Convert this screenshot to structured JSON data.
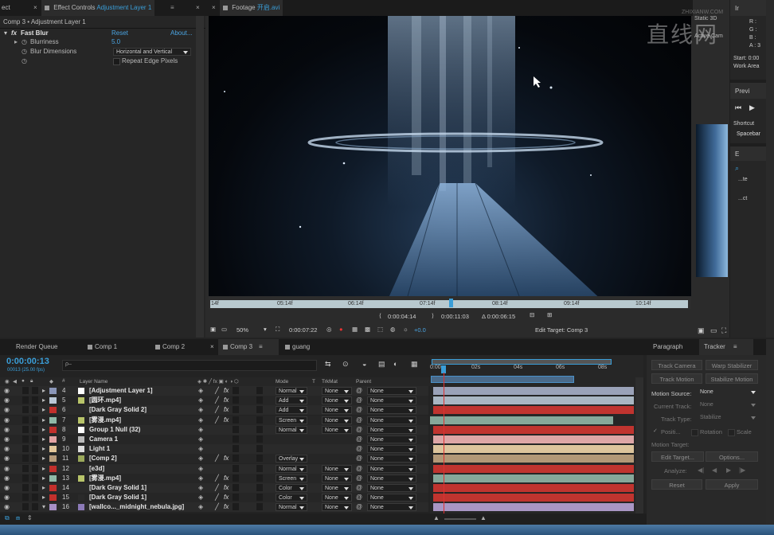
{
  "effect_controls": {
    "tab_label": "Effect Controls",
    "tab_layer": "Adjustment Layer 1",
    "left_tab_fragment": "ect",
    "header": "Comp 3 • Adjustment Layer 1",
    "effect_name": "Fast Blur",
    "reset_label": "Reset",
    "about_label": "About...",
    "blurriness_label": "Blurriness",
    "blurriness_value": "5.0",
    "blur_dimensions_label": "Blur Dimensions",
    "blur_dimensions_value": "Horizontal and Vertical",
    "repeat_edge_label": "Repeat Edge Pixels"
  },
  "footage_viewer": {
    "tab_label": "Footage",
    "file_name": "开启.avi",
    "ruler_ticks": [
      "14f",
      "05:14f",
      "06:14f",
      "07:14f",
      "08:14f",
      "09:14f",
      "10:14f"
    ],
    "in_time": "0:00:04:14",
    "out_time": "0:00:11:03",
    "duration": "Δ 0:00:06:15",
    "zoom": "50%",
    "current_time": "0:00:07:22",
    "exposure": "+0.0",
    "edit_target": "Edit Target: Comp 3"
  },
  "right_panels": {
    "info_tab": "Ir",
    "info_lines": [
      "R :",
      "G :",
      "B :",
      "A : 3"
    ],
    "start_label": "Start: 0:00",
    "work_area_label": "Work Area",
    "preview_tab": "Previ",
    "shortcut_label": "Shortcut",
    "shortcut_value": "Spacebar",
    "effects_tab": "E",
    "effects_items": [
      "...te",
      "...ct"
    ],
    "behind_fragment_1": "Static 3D",
    "behind_fragment_2": "Active Cam"
  },
  "watermark": {
    "text": "直线网",
    "sub": "ZHIXIANW.COM"
  },
  "timeline_tabs": [
    {
      "label": "Render Queue",
      "active": false
    },
    {
      "label": "Comp 1",
      "active": false
    },
    {
      "label": "Comp 2",
      "active": false
    },
    {
      "label": "Comp 3",
      "active": true
    },
    {
      "label": "guang",
      "active": false
    }
  ],
  "timeline": {
    "time": "0:00:00:13",
    "fps_info": "00013 (25.00 fps)",
    "search_placeholder": "ρ–",
    "col_layer_name": "Layer Name",
    "col_mode": "Mode",
    "col_trkmat": "TrkMat",
    "col_parent": "Parent",
    "ruler_ticks": [
      "0:00s",
      "02s",
      "04s",
      "06s",
      "08s"
    ],
    "layers": [
      {
        "num": "4",
        "name": "[Adjustment Layer 1]",
        "label_color": "#8a96b8",
        "icon_color": "#ffffff",
        "mode": "Normal",
        "trkmat": "None",
        "parent": "None",
        "bar_color": "#9aa2b8",
        "fx": true
      },
      {
        "num": "5",
        "name": "[圆环.mp4]",
        "label_color": "#b9c7d6",
        "icon_color": "#b8c46a",
        "mode": "Add",
        "trkmat": "None",
        "parent": "None",
        "bar_color": "#a9b6c2",
        "fx": true
      },
      {
        "num": "6",
        "name": "[Dark Gray Solid 2]",
        "label_color": "#c2302c",
        "icon_color": "#2a2a2a",
        "mode": "Add",
        "trkmat": "None",
        "parent": "None",
        "bar_color": "#c0342f",
        "fx": true
      },
      {
        "num": "7",
        "name": "[雾漫.mp4]",
        "label_color": "#8fb9a8",
        "icon_color": "#b8c46a",
        "mode": "Screen",
        "trkmat": "None",
        "parent": "None",
        "bar_color": "#86a89a",
        "fx": true
      },
      {
        "num": "8",
        "name": "Group 1 Null (32)",
        "label_color": "#c2302c",
        "icon_color": "#ffffff",
        "mode": "Normal",
        "trkmat": "None",
        "parent": "None",
        "bar_color": "#c0342f",
        "fx": false
      },
      {
        "num": "9",
        "name": "Camera 1",
        "label_color": "#e3a3a3",
        "icon_color": "#bbbbbb",
        "mode": "",
        "trkmat": "",
        "parent": "None",
        "bar_color": "#dda6a6",
        "fx": false
      },
      {
        "num": "10",
        "name": "Light 1",
        "label_color": "#e3c79a",
        "icon_color": "#dddddd",
        "mode": "",
        "trkmat": "",
        "parent": "None",
        "bar_color": "#dcc49c",
        "fx": false
      },
      {
        "num": "11",
        "name": "[Comp 2]",
        "label_color": "#b59a7a",
        "icon_color": "#9aa85a",
        "mode": "Overlay",
        "trkmat": "",
        "parent": "None",
        "bar_color": "#b29877",
        "fx": true
      },
      {
        "num": "12",
        "name": "[e3d]",
        "label_color": "#c2302c",
        "icon_color": "#2a2a2a",
        "mode": "Normal",
        "trkmat": "None",
        "parent": "None",
        "bar_color": "#c0342f",
        "fx": false
      },
      {
        "num": "13",
        "name": "[雾漫.mp4]",
        "label_color": "#8fb9a8",
        "icon_color": "#b8c46a",
        "mode": "Screen",
        "trkmat": "None",
        "parent": "None",
        "bar_color": "#86a89a",
        "fx": true
      },
      {
        "num": "14",
        "name": "[Dark Gray Solid 1]",
        "label_color": "#c2302c",
        "icon_color": "#2a2a2a",
        "mode": "Color",
        "trkmat": "None",
        "parent": "None",
        "bar_color": "#c0342f",
        "fx": true
      },
      {
        "num": "15",
        "name": "[Dark Gray Solid 1]",
        "label_color": "#c2302c",
        "icon_color": "#2a2a2a",
        "mode": "Color",
        "trkmat": "None",
        "parent": "None",
        "bar_color": "#c0342f",
        "fx": true
      },
      {
        "num": "16",
        "name": "[wallco..._midnight_nebula.jpg]",
        "label_color": "#a78fc6",
        "icon_color": "#8c7ab8",
        "mode": "Normal",
        "trkmat": "None",
        "parent": "None",
        "bar_color": "#a996c4",
        "fx": true
      }
    ]
  },
  "tracker": {
    "tab_paragraph": "Paragraph",
    "tab_tracker": "Tracker",
    "track_camera": "Track Camera",
    "warp_stabilizer": "Warp Stabilizer",
    "track_motion": "Track Motion",
    "stabilize_motion": "Stabilize Motion",
    "motion_source_label": "Motion Source:",
    "motion_source_value": "None",
    "current_track_label": "Current Track:",
    "current_track_value": "None",
    "track_type_label": "Track Type:",
    "track_type_value": "Stabilize",
    "position_label": "Positi...",
    "rotation_label": "Rotation",
    "scale_label": "Scale",
    "motion_target_label": "Motion Target:",
    "edit_target_button": "Edit Target...",
    "options_button": "Options...",
    "analyze_label": "Analyze:",
    "reset_button": "Reset",
    "apply_button": "Apply"
  },
  "colors": {
    "accent_blue": "#3a9ed8",
    "work_area_blue": "#4a90c8",
    "cti_red": "#e03030"
  }
}
